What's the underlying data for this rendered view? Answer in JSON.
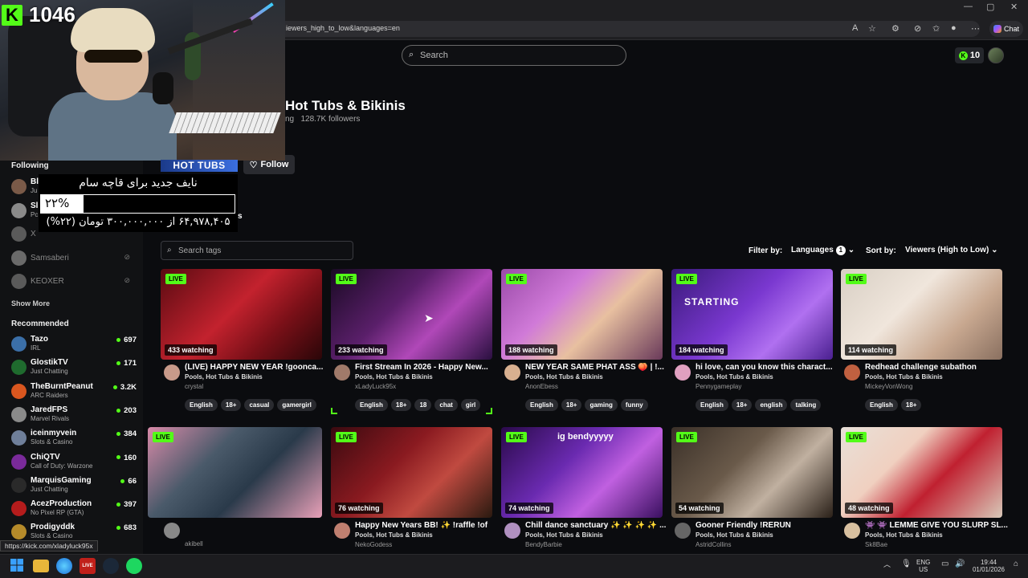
{
  "browser": {
    "url": "iewers_high_to_low&languages=en",
    "chat_label": "Chat",
    "status_url": "https://kick.com/xladyluck95x"
  },
  "header": {
    "search_placeholder": "Search",
    "kicks_count": "10"
  },
  "webcam": {
    "viewer_count": "1046",
    "logo_letter": "K"
  },
  "category": {
    "title": "Hot Tubs & Bikinis",
    "subtitle_prefix": "ng",
    "followers": "128.7K followers",
    "follow_label": "Follow",
    "banner_text": "HOT TUBS",
    "cut_text": "s"
  },
  "donation": {
    "title": "نایف جدید برای قاچه سام",
    "percent_text": "۲۲%",
    "percent_value": 0.22,
    "amount_text": "۶۴,۹۷۸,۴۰۵ از ۳۰۰,۰۰۰,۰۰۰ تومان (۲۲%)"
  },
  "sidebar": {
    "following_label": "Following",
    "following": [
      {
        "name": "Bl",
        "category": "Ju",
        "color": "#7a5a48"
      },
      {
        "name": "Sl",
        "category": "Pc",
        "color": "#8a8a8a"
      },
      {
        "name": "X",
        "category": "",
        "color": "#5a5a5a"
      },
      {
        "name": "Samsaberi",
        "category": "",
        "color": "#6a6a6a"
      },
      {
        "name": "KEOXER",
        "category": "",
        "color": "#5a5a5a"
      }
    ],
    "show_more": "Show More",
    "recommended_label": "Recommended",
    "recommended": [
      {
        "name": "Tazo",
        "category": "IRL",
        "viewers": "697",
        "color": "#3b6fa8"
      },
      {
        "name": "GlostikTV",
        "category": "Just Chatting",
        "viewers": "171",
        "color": "#1f6b2e"
      },
      {
        "name": "TheBurntPeanut",
        "category": "ARC Raiders",
        "viewers": "3.2K",
        "color": "#d9561f"
      },
      {
        "name": "JaredFPS",
        "category": "Marvel Rivals",
        "viewers": "203",
        "color": "#8a8a8a"
      },
      {
        "name": "iceinmyvein",
        "category": "Slots & Casino",
        "viewers": "384",
        "color": "#6f7f9a"
      },
      {
        "name": "ChiQTV",
        "category": "Call of Duty: Warzone",
        "viewers": "160",
        "color": "#7a2a9a"
      },
      {
        "name": "MarquisGaming",
        "category": "Just Chatting",
        "viewers": "66",
        "color": "#2a2a2a"
      },
      {
        "name": "AcezProduction",
        "category": "No Pixel RP (GTA)",
        "viewers": "397",
        "color": "#b51c1c"
      },
      {
        "name": "Prodigyddk",
        "category": "Slots & Casino",
        "viewers": "683",
        "color": "#b58a2a"
      }
    ]
  },
  "filters": {
    "search_tags_placeholder": "Search tags",
    "filter_by_label": "Filter by:",
    "languages_label": "Languages",
    "languages_count": "1",
    "sort_by_label": "Sort by:",
    "sort_value": "Viewers (High to Low)"
  },
  "streams": [
    {
      "title": "(LIVE) HAPPY NEW YEAR !gooncа...",
      "category": "Pools, Hot Tubs & Bikinis",
      "user": "crystal",
      "watching": "433 watching",
      "live": "LIVE",
      "tags": [
        "English",
        "18+",
        "casual",
        "gamergirl"
      ],
      "bg": "linear-gradient(135deg,#5a0b12 0%,#c3222e 45%,#7a1018 70%,#2a0608 100%)",
      "av": "#c89a8a"
    },
    {
      "title": "First Stream In 2026 - Happy New...",
      "category": "Pools, Hot Tubs & Bikinis",
      "user": "xLadyLuck95x",
      "watching": "233 watching",
      "live": "LIVE",
      "tags": [
        "English",
        "18+",
        "18",
        "chat",
        "girl"
      ],
      "bg": "linear-gradient(135deg,#1a0a24 0%,#5a1f6a 40%,#b048b8 65%,#2a1040 100%)",
      "av": "#a07a6a"
    },
    {
      "title": "NEW YEAR SAME PHAT ASS 🍑 | !...",
      "category": "Pools, Hot Tubs & Bikinis",
      "user": "AnonEbess",
      "watching": "188 watching",
      "live": "LIVE",
      "tags": [
        "English",
        "18+",
        "gaming",
        "funny"
      ],
      "bg": "linear-gradient(135deg,#9a4aa8 0%,#d07ad8 35%,#e8c0a0 60%,#6a3a5a 100%)",
      "av": "#d8b090"
    },
    {
      "title": "hi love, can you know this charact...",
      "category": "Pools, Hot Tubs & Bikinis",
      "user": "Pennygameplay",
      "watching": "184 watching",
      "live": "LIVE",
      "tags": [
        "English",
        "18+",
        "english",
        "talking"
      ],
      "bg": "linear-gradient(135deg,#3a1a7a 0%,#7a38d0 45%,#b070f0 70%,#4a2090 100%)",
      "overlay": "STARTING",
      "av": "#e0a0c0"
    },
    {
      "title": "Redhead challenge subathon",
      "category": "Pools, Hot Tubs & Bikinis",
      "user": "MickeyVonWong",
      "watching": "114 watching",
      "live": "LIVE",
      "tags": [
        "English",
        "18+"
      ],
      "bg": "linear-gradient(135deg,#d8cfc4 0%,#f0e6dc 40%,#c8a890 70%,#8a7060 100%)",
      "av": "#c06040"
    },
    {
      "title": "",
      "category": "",
      "user": "akibell",
      "watching": "",
      "live": "LIVE",
      "tags": [],
      "bg": "linear-gradient(135deg,#d88aa8 0%,#4a5a6a 35%,#2a3a4a 60%,#e8a0b8 100%)",
      "av": "#888"
    },
    {
      "title": "Happy New Years BB! ✨ !raffle !of",
      "category": "Pools, Hot Tubs & Bikinis",
      "user": "NekoGodess",
      "watching": "76 watching",
      "live": "LIVE",
      "tags": [],
      "bg": "linear-gradient(135deg,#3a0a10 0%,#8a1a20 40%,#c04a40 65%,#2a1a10 100%)",
      "av": "#c08070"
    },
    {
      "title": "Chill dance sanctuary ✨ ✨ ✨ ✨ ...",
      "category": "Pools, Hot Tubs & Bikinis",
      "user": "BendyBarbie",
      "watching": "74 watching",
      "live": "LIVE",
      "tags": [],
      "overlay": "ig bendyyyyy",
      "bg": "linear-gradient(135deg,#2a0a4a 0%,#6a2ab0 40%,#c060e0 65%,#3a1060 100%)",
      "av": "#b090c0"
    },
    {
      "title": "Gooner Friendly !RERUN",
      "category": "Pools, Hot Tubs & Bikinis",
      "user": "AstridCollins",
      "watching": "54 watching",
      "live": "LIVE",
      "tags": [],
      "bg": "linear-gradient(135deg,#3a3028 0%,#6a5a4a 40%,#c0b0a0 65%,#2a2018 100%)",
      "av": "#666"
    },
    {
      "title": "👾 👾 LEMME GIVE YOU SLURP SL...",
      "category": "Pools, Hot Tubs & Bikinis",
      "user": "Sk8Bae",
      "watching": "48 watching",
      "live": "LIVE",
      "tags": [],
      "bg": "linear-gradient(135deg,#e8e0d8 0%,#f0d0c0 35%,#c02030 60%,#d8c8b8 100%)",
      "av": "#d8c0a0"
    }
  ],
  "taskbar": {
    "lang_top": "ENG",
    "lang_bottom": "US",
    "time": "19:44",
    "date": "01/01/2026",
    "live_badge": "LIVE"
  }
}
